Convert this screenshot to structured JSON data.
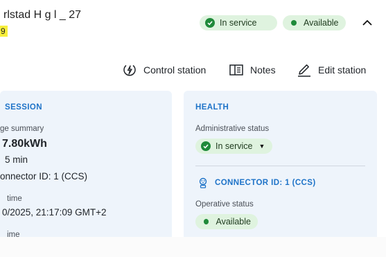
{
  "header": {
    "title": "rlstad H  g          l  _  27",
    "tag": "9",
    "service_status": "In service",
    "availability": "Available"
  },
  "actions": {
    "control_station": "Control station",
    "notes": "Notes",
    "edit_station": "Edit station"
  },
  "session": {
    "title": "SESSION",
    "summary_label": "ge summary",
    "energy": "7.80kWh",
    "duration": "5 min",
    "connector": "onnector ID: 1 (CCS)",
    "start_label": "time",
    "start_value": "0/2025, 21:17:09 GMT+2",
    "end_label": "ime"
  },
  "health": {
    "title": "HEALTH",
    "admin_label": "Administrative status",
    "admin_value": "In service",
    "connector_title": "CONNECTOR ID: 1 (CCS)",
    "operative_label": "Operative status",
    "operative_value": "Available"
  },
  "colors": {
    "accent": "#1e73c8",
    "status_green": "#1f8a3a",
    "pill_bg": "#dff3df",
    "card_bg": "#eef4fb",
    "highlight": "#f7ef3b"
  }
}
